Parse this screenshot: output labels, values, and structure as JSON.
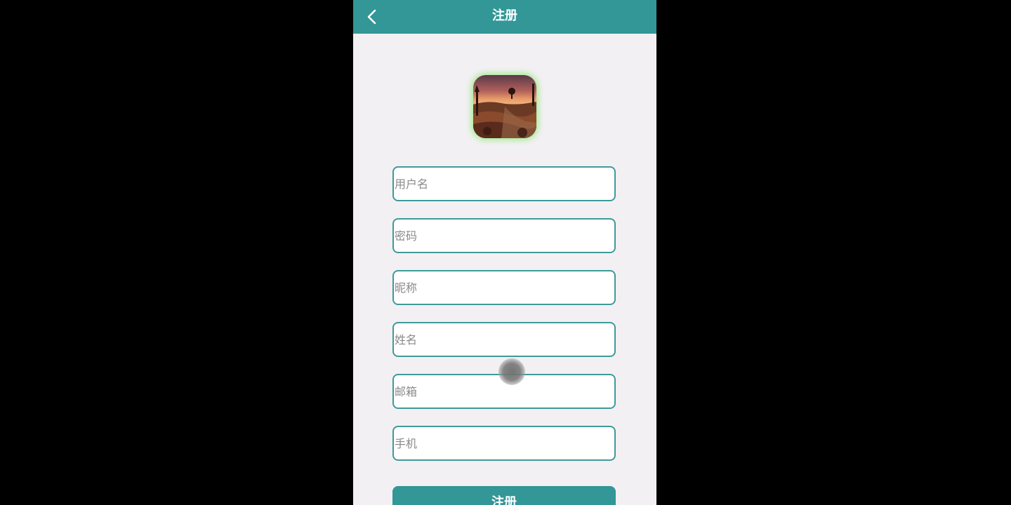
{
  "header": {
    "title": "注册",
    "back_icon": "chevron-left-icon"
  },
  "avatar": {
    "description_icon": "avatar-image"
  },
  "form": {
    "username_placeholder": "用户名",
    "password_placeholder": "密码",
    "nickname_placeholder": "昵称",
    "name_placeholder": "姓名",
    "email_placeholder": "邮箱",
    "phone_placeholder": "手机",
    "submit_label": "注册"
  },
  "colors": {
    "accent": "#339697",
    "field_border": "#3f9a9a",
    "background": "#f2f0f3",
    "avatar_glow": "#a0eb8c"
  }
}
